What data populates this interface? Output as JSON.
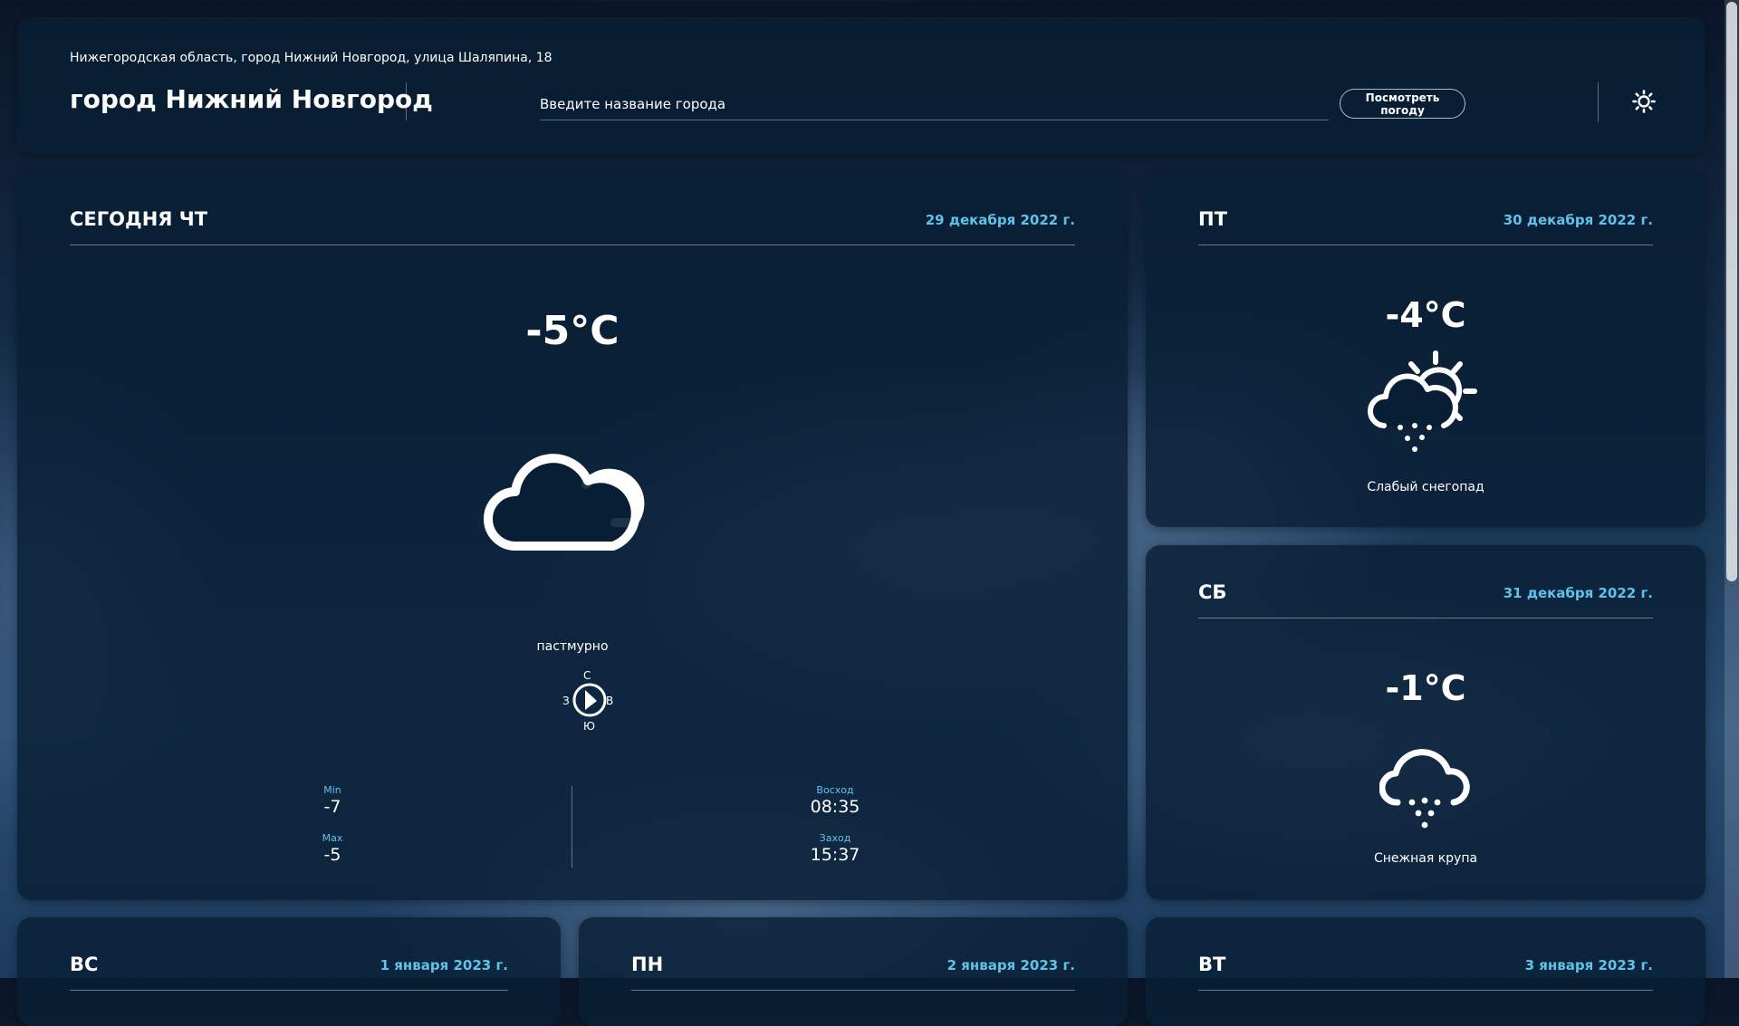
{
  "header": {
    "address": "Нижегородская область, город Нижний Новгород, улица Шаляпина, 18",
    "city": "город Нижний Новгород",
    "search_placeholder": "Введите название города",
    "search_button": "Посмотреть погоду",
    "theme_icon": "sun-icon"
  },
  "today": {
    "day": "СЕГОДНЯ ЧТ",
    "date": "29 декабря 2022 г.",
    "temp": "-5°C",
    "icon": "cloudy-icon",
    "description": "пастмурно",
    "compass": {
      "n": "С",
      "s": "Ю",
      "w": "З",
      "e": "В"
    },
    "min_label": "Min",
    "min_value": "-7",
    "max_label": "Max",
    "max_value": "-5",
    "sunrise_label": "Восход",
    "sunrise_value": "08:35",
    "sunset_label": "Заход",
    "sunset_value": "15:37"
  },
  "forecast": [
    {
      "day": "ПТ",
      "date": "30 декабря 2022 г.",
      "temp": "-4°C",
      "icon": "partly-cloudy-snow-icon",
      "description": "Слабый снегопад"
    },
    {
      "day": "СБ",
      "date": "31 декабря 2022 г.",
      "temp": "-1°C",
      "icon": "snow-cloud-icon",
      "description": "Снежная крупа"
    },
    {
      "day": "ВС",
      "date": "1 января 2023 г."
    },
    {
      "day": "ПН",
      "date": "2 января 2023 г."
    },
    {
      "day": "ВТ",
      "date": "3 января 2023 г."
    }
  ],
  "colors": {
    "accent": "#5ec3ea",
    "panel": "#081e34"
  }
}
